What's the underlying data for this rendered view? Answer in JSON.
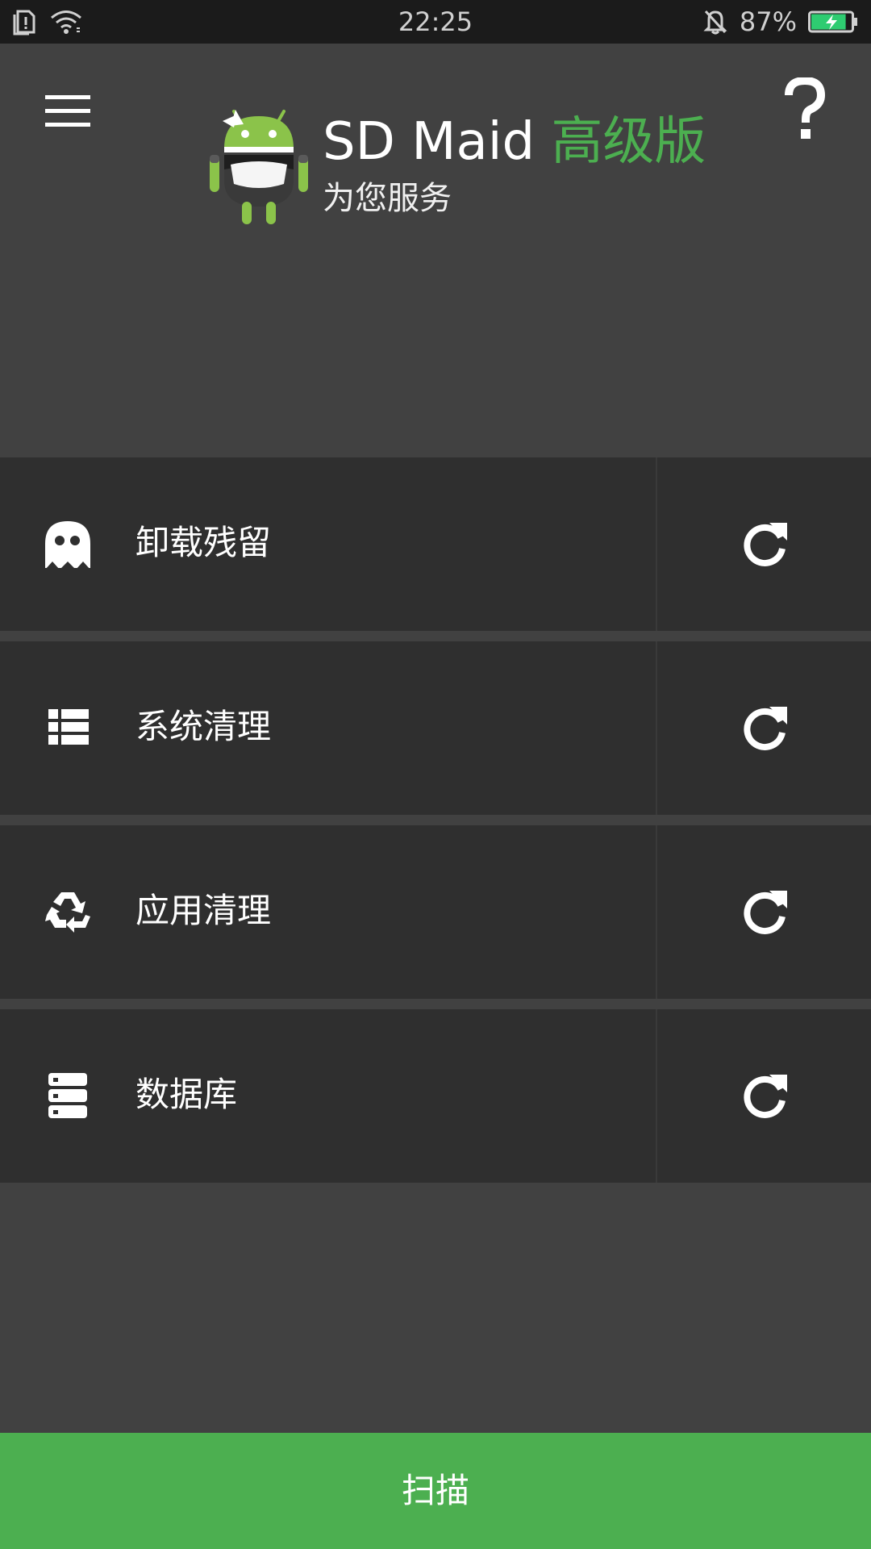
{
  "status_bar": {
    "time": "22:25",
    "battery_percent": "87%",
    "battery_level": 0.87,
    "icons": [
      "sim-alert-icon",
      "wifi-icon",
      "bell-off-icon",
      "battery-charging-icon"
    ]
  },
  "header": {
    "title_main": "SD Maid",
    "title_pro": "高级版",
    "subtitle": "为您服务",
    "icons": [
      "menu-icon",
      "help-icon",
      "android-maid-logo"
    ]
  },
  "tools": [
    {
      "label": "卸载残留",
      "icon": "ghost-icon"
    },
    {
      "label": "系统清理",
      "icon": "list-icon"
    },
    {
      "label": "应用清理",
      "icon": "recycle-icon"
    },
    {
      "label": "数据库",
      "icon": "database-icon"
    }
  ],
  "scan_button": {
    "label": "扫描"
  },
  "colors": {
    "accent": "#4caf50",
    "background": "#414141",
    "row_background": "#2f2f2f",
    "status_bar": "#1b1b1b",
    "battery_fill": "#2ecc71"
  }
}
